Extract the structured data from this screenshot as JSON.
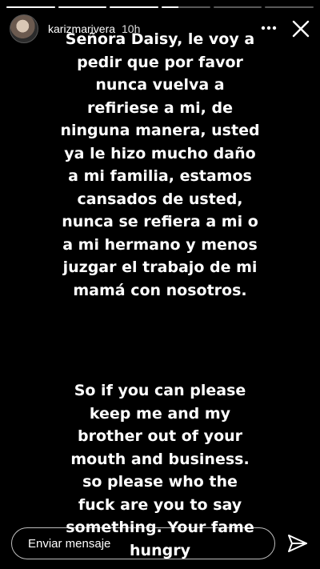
{
  "story": {
    "progress": [
      1,
      1,
      1,
      0.35,
      0,
      0
    ],
    "username": "karizmarivera",
    "time": "10h",
    "text_block_1": "Señora Daisy, le voy a\npedir que por favor\nnunca vuelva a\nrefiriese a mi, de\nninguna manera, usted\nya le hizo mucho daño\na mi familia, estamos\ncansados de usted,\nnunca se refiera a mi o\na mi hermano y menos\njuzgar el trabajo de mi\nmamá con nosotros.",
    "text_block_2": "So if you can please\nkeep me and my\nbrother out of your\nmouth and business.\nso please who the\nfuck are you to say\nsomething. Your fame\nhungry"
  },
  "header": {
    "more_icon": "more-horizontal-icon",
    "close_icon": "close-icon"
  },
  "footer": {
    "message_placeholder": "Enviar mensaje",
    "send_icon": "send-icon"
  }
}
